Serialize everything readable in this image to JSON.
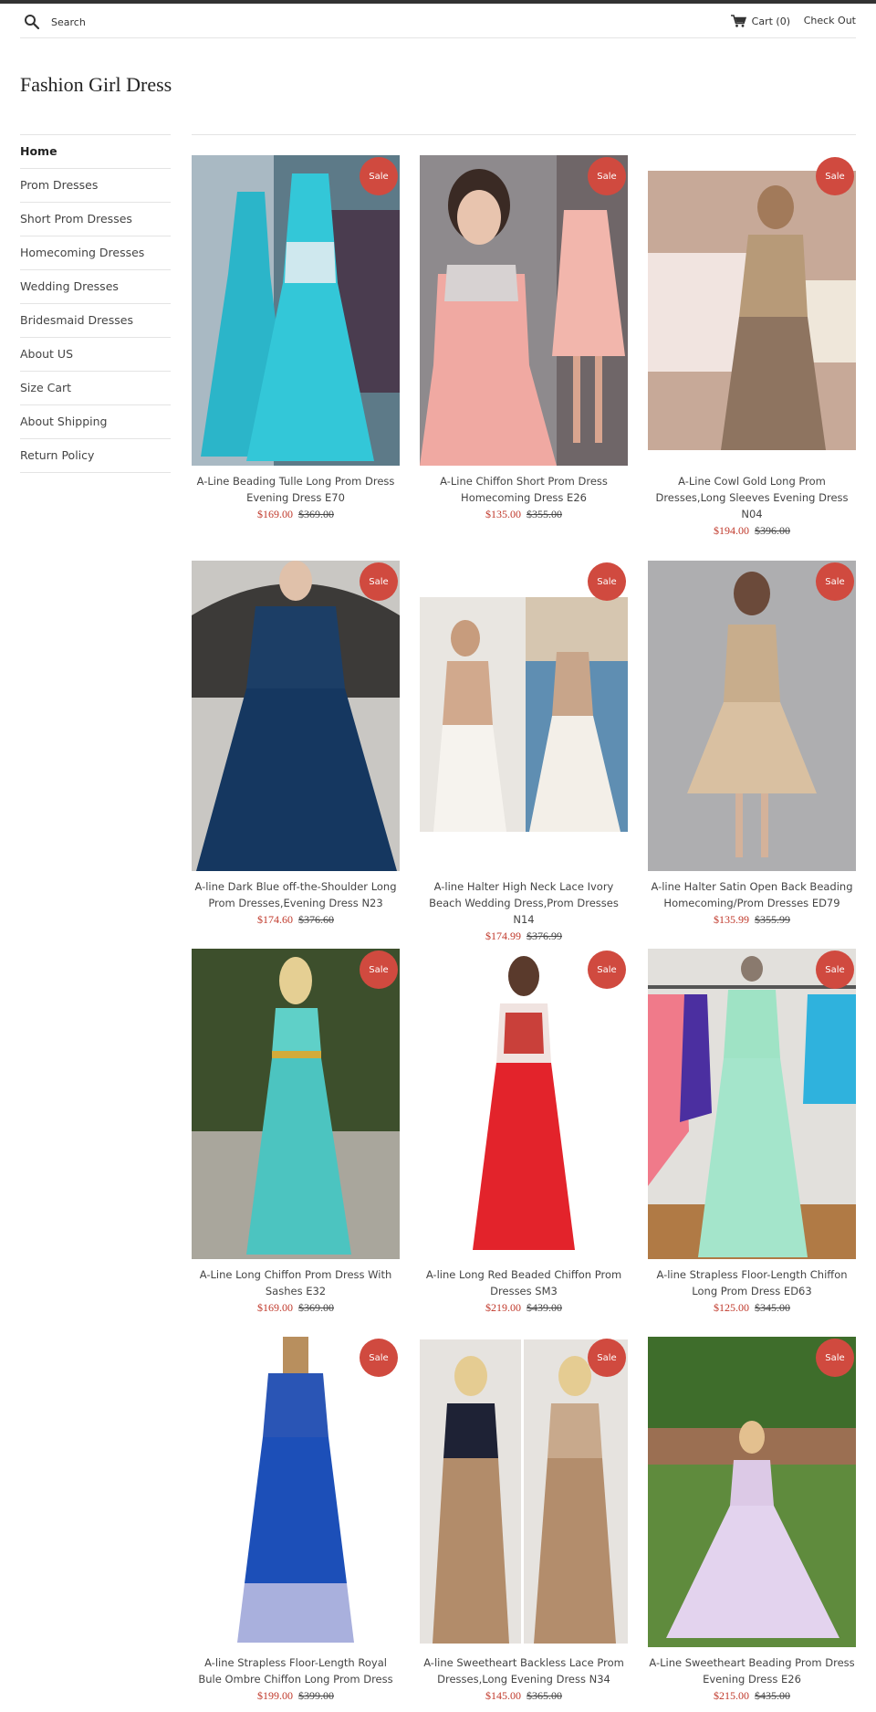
{
  "header": {
    "search_placeholder": "Search",
    "cart_label": "Cart (0)",
    "checkout_label": "Check Out"
  },
  "logo": "Fashion Girl Dress",
  "nav": [
    {
      "label": "Home"
    },
    {
      "label": "Prom Dresses"
    },
    {
      "label": "Short Prom Dresses"
    },
    {
      "label": "Homecoming Dresses"
    },
    {
      "label": "Wedding Dresses"
    },
    {
      "label": "Bridesmaid Dresses"
    },
    {
      "label": "About US"
    },
    {
      "label": "Size Cart"
    },
    {
      "label": "About Shipping"
    },
    {
      "label": "Return Policy"
    }
  ],
  "badge_label": "Sale",
  "products": [
    {
      "title": "A-Line Beading Tulle Long Prom Dress Evening Dress E70",
      "price": "$169.00",
      "was": "$369.00"
    },
    {
      "title": "A-Line Chiffon Short Prom Dress Homecoming Dress E26",
      "price": "$135.00",
      "was": "$355.00"
    },
    {
      "title": "A-Line Cowl Gold Long Prom Dresses,Long Sleeves Evening Dress N04",
      "price": "$194.00",
      "was": "$396.00"
    },
    {
      "title": "A-line Dark Blue off-the-Shoulder Long Prom Dresses,Evening Dress N23",
      "price": "$174.60",
      "was": "$376.60"
    },
    {
      "title": "A-line Halter High Neck Lace Ivory Beach Wedding Dress,Prom Dresses N14",
      "price": "$174.99",
      "was": "$376.99"
    },
    {
      "title": "A-line Halter Satin Open Back Beading Homecoming/Prom Dresses ED79",
      "price": "$135.99",
      "was": "$355.99"
    },
    {
      "title": "A-Line Long Chiffon Prom Dress With Sashes E32",
      "price": "$169.00",
      "was": "$369.00"
    },
    {
      "title": "A-line Long Red Beaded Chiffon Prom Dresses SM3",
      "price": "$219.00",
      "was": "$439.00"
    },
    {
      "title": "A-line Strapless Floor-Length Chiffon Long Prom Dress ED63",
      "price": "$125.00",
      "was": "$345.00"
    },
    {
      "title": "A-line Strapless Floor-Length Royal Bule Ombre Chiffon Long Prom Dress",
      "price": "$199.00",
      "was": "$399.00"
    },
    {
      "title": "A-line Sweetheart Backless Lace Prom Dresses,Long Evening Dress N34",
      "price": "$145.00",
      "was": "$365.00"
    },
    {
      "title": "A-Line Sweetheart Beading Prom Dress Evening Dress E26",
      "price": "$215.00",
      "was": "$435.00"
    }
  ]
}
